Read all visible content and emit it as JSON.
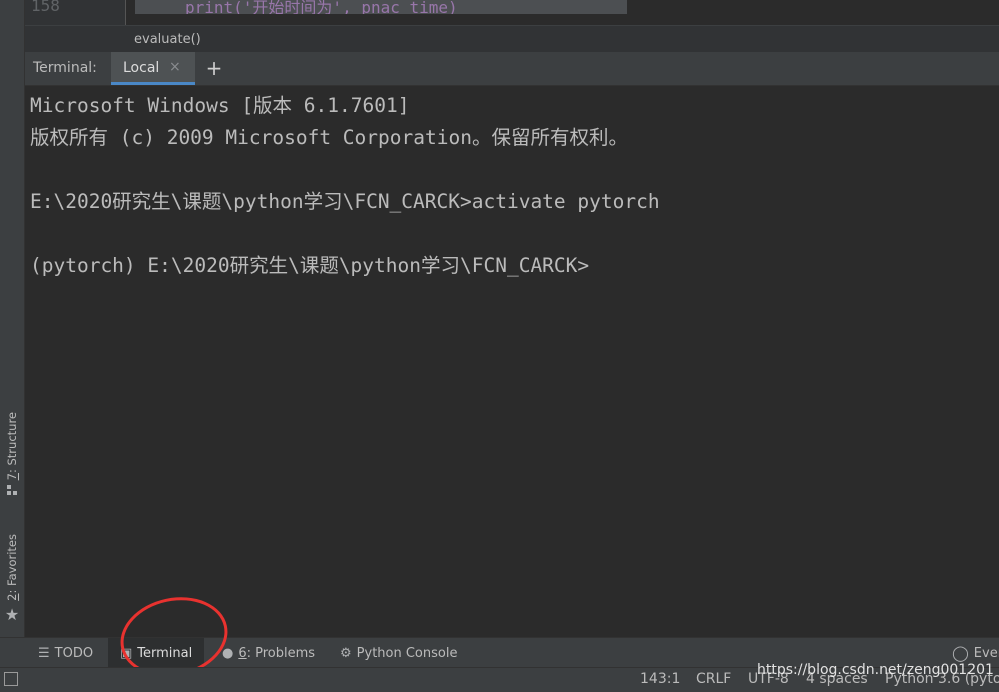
{
  "editor": {
    "line_number": "158",
    "code_line": "print('开始时间为', pnac_time)",
    "breadcrumb": "evaluate()"
  },
  "left_strip": {
    "structure_label_prefix": "7",
    "structure_label": ": Structure",
    "favorites_label_prefix": "2",
    "favorites_label": ": Favorites"
  },
  "terminal": {
    "title": "Terminal:",
    "tab_label": "Local",
    "close_icon": "×",
    "new_tab_icon": "+",
    "lines": [
      "Microsoft Windows [版本 6.1.7601]",
      "版权所有 (c) 2009 Microsoft Corporation。保留所有权利。",
      "",
      "E:\\2020研究生\\课题\\python学习\\FCN_CARCK>activate pytorch",
      "",
      "(pytorch) E:\\2020研究生\\课题\\python学习\\FCN_CARCK>"
    ]
  },
  "tool_bar": {
    "todo": "TODO",
    "terminal": "Terminal",
    "problems_prefix": "6",
    "problems": ": Problems",
    "python_console": "Python Console",
    "event_log": "Even"
  },
  "status_bar": {
    "position": "143:1",
    "line_separator": "CRLF",
    "encoding": "UTF-8",
    "indent": "4 spaces",
    "interpreter": "Python 3.6 (pyto"
  },
  "watermark": "https://blog.csdn.net/zeng001201"
}
